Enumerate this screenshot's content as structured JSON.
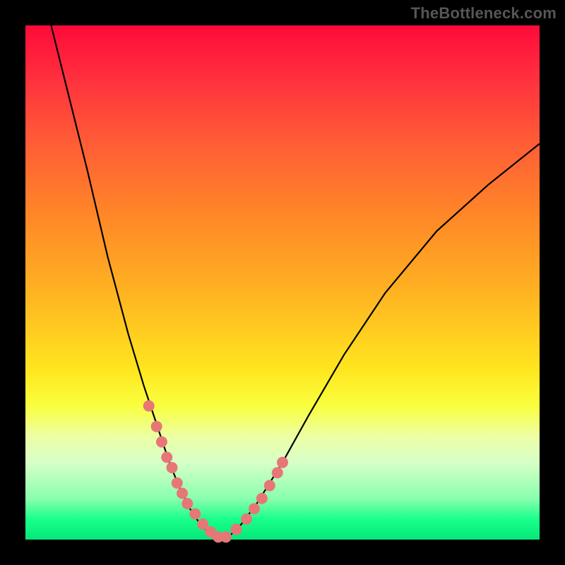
{
  "attribution": "TheBottleneck.com",
  "colors": {
    "background": "#000000",
    "dot": "#e77777",
    "curve": "#000000",
    "gradient_top": "#ff0a3a",
    "gradient_bottom": "#05e87a"
  },
  "chart_data": {
    "type": "line",
    "title": "",
    "xlabel": "",
    "ylabel": "",
    "xlim": [
      0,
      100
    ],
    "ylim": [
      0,
      100
    ],
    "grid": false,
    "legend": false,
    "note": "V-shaped curve with minimum near x≈37; y is bottleneck-like metric (0 at valley).",
    "series": [
      {
        "name": "curve",
        "x": [
          5,
          8,
          12,
          16,
          20,
          23,
          26,
          28,
          30,
          32,
          34,
          36,
          38,
          40,
          42,
          45,
          50,
          55,
          62,
          70,
          80,
          90,
          100
        ],
        "y": [
          100,
          88,
          72,
          55,
          40,
          30,
          21,
          15,
          10,
          6,
          3,
          1,
          0.3,
          1,
          3,
          7,
          15,
          24,
          36,
          48,
          60,
          69,
          77
        ]
      },
      {
        "name": "dots-overlay",
        "x": [
          24,
          25.5,
          26.5,
          27.5,
          28.5,
          29.5,
          30.5,
          31.5,
          33,
          34.5,
          36,
          37.5,
          39,
          41,
          43,
          44.5,
          46,
          47.5,
          49,
          50
        ],
        "y": [
          26,
          22,
          19,
          16,
          14,
          11,
          9,
          7,
          5,
          3,
          1.5,
          0.5,
          0.5,
          2,
          4,
          6,
          8,
          10.5,
          13,
          15
        ]
      }
    ]
  }
}
